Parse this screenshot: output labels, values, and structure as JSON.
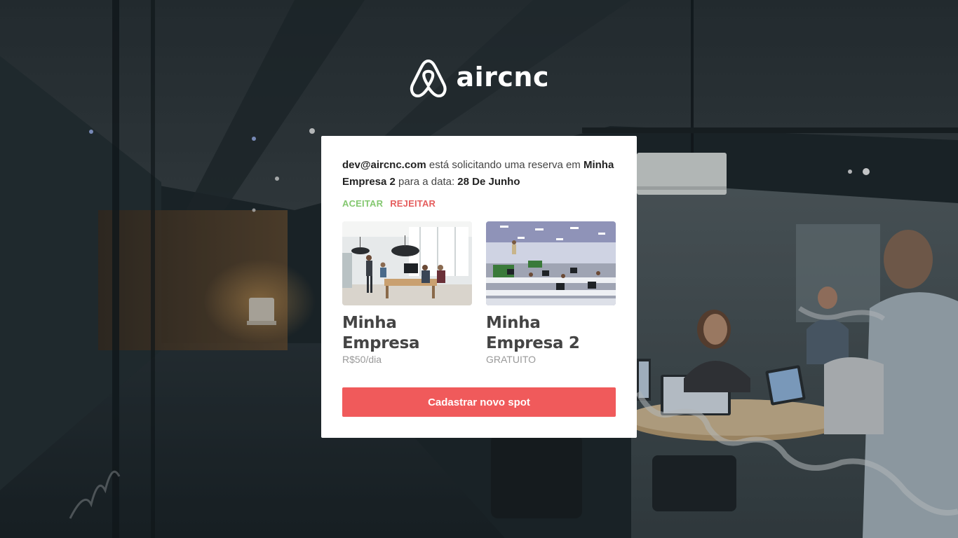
{
  "app": {
    "brand": "aircnc",
    "logo_icon": "airbnb-belo-icon"
  },
  "booking_request": {
    "user_email": "dev@aircnc.com",
    "text_requesting": " está solicitando uma reserva em",
    "spot_name": "Minha Empresa 2",
    "text_for_date": " para a data: ",
    "date": "28 De Junho",
    "accept_label": "ACEITAR",
    "reject_label": "REJEITAR"
  },
  "spots": [
    {
      "company": "Minha Empresa",
      "price": "R$50/dia"
    },
    {
      "company": "Minha Empresa 2",
      "price": "GRATUITO"
    }
  ],
  "actions": {
    "new_spot_label": "Cadastrar novo spot"
  },
  "colors": {
    "accent": "#f05a5b",
    "accept": "#84c870",
    "reject": "#e55e5e",
    "card_bg": "#ffffff"
  }
}
